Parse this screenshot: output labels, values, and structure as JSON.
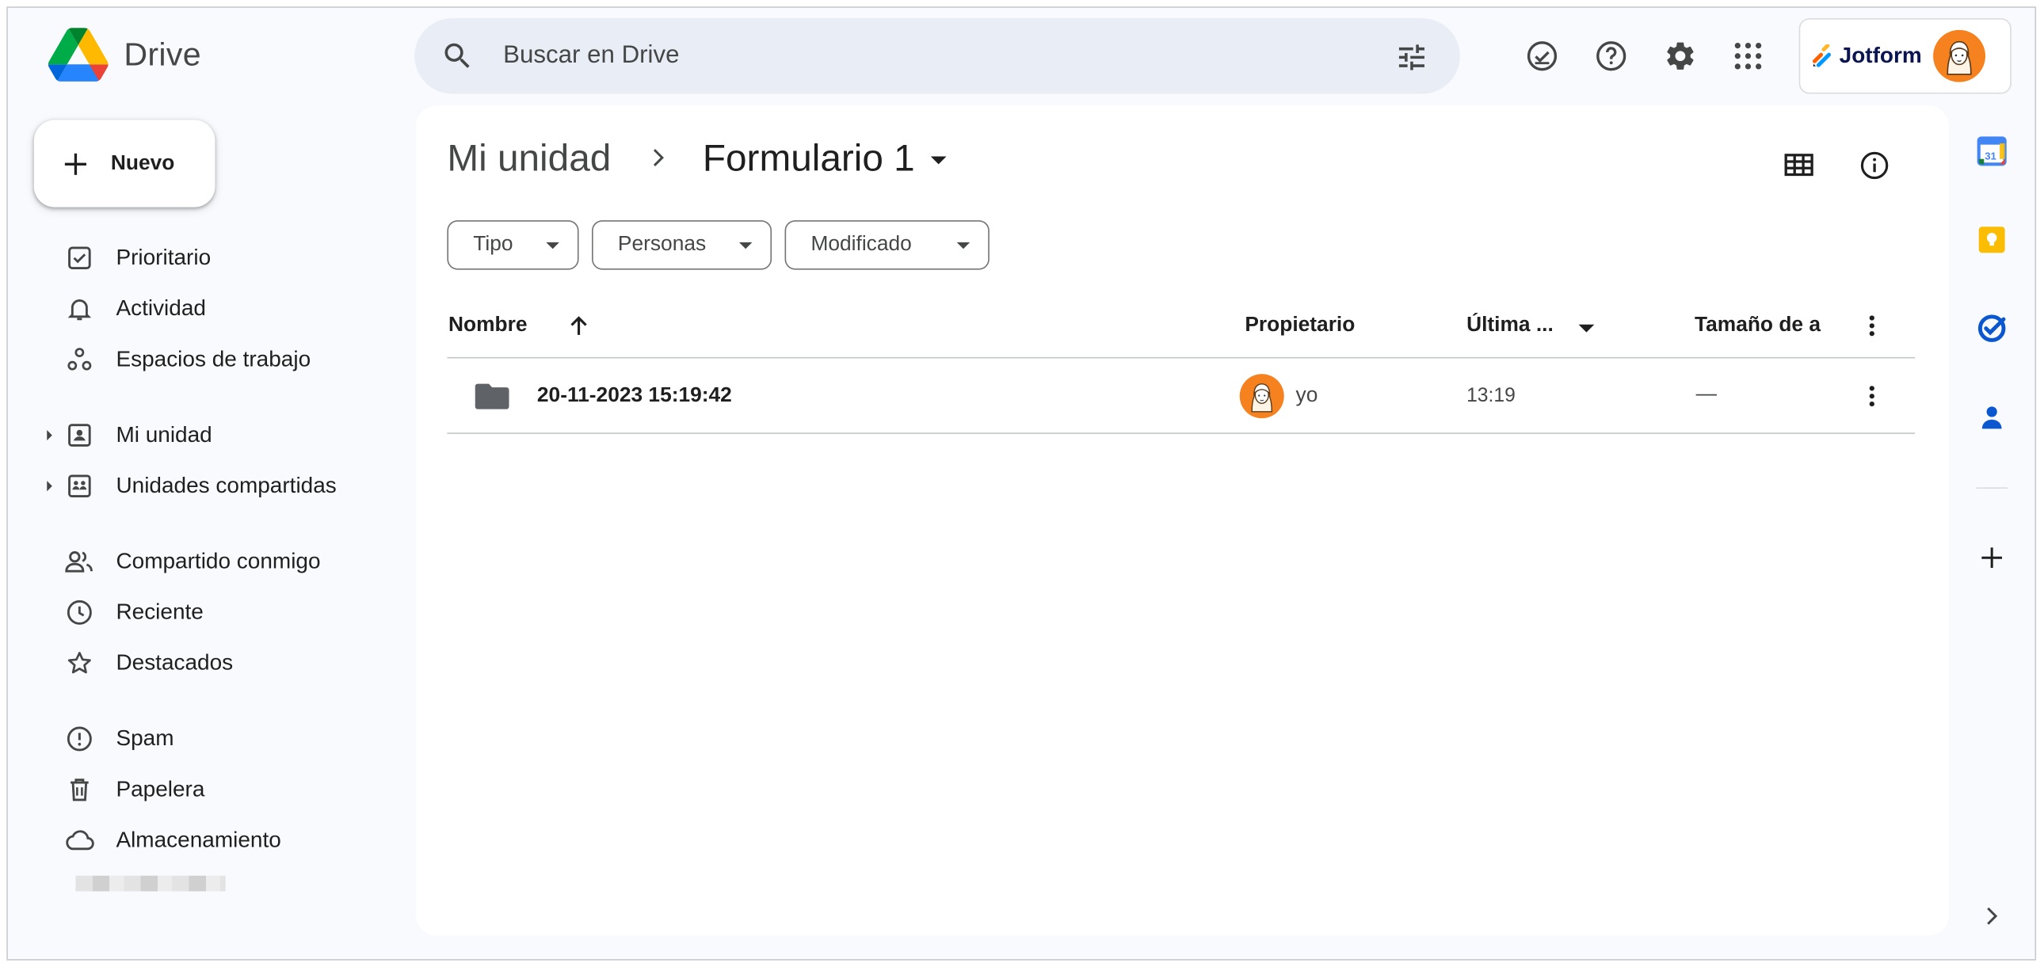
{
  "app": {
    "name": "Drive"
  },
  "search": {
    "placeholder": "Buscar en Drive"
  },
  "account": {
    "brand": "Jotform"
  },
  "new_button": {
    "label": "Nuevo"
  },
  "sidebar": {
    "items": [
      {
        "label": "Prioritario",
        "icon": "priority-icon"
      },
      {
        "label": "Actividad",
        "icon": "bell-icon"
      },
      {
        "label": "Espacios de trabajo",
        "icon": "workspaces-icon"
      },
      {
        "label": "Mi unidad",
        "icon": "my-drive-icon"
      },
      {
        "label": "Unidades compartidas",
        "icon": "shared-drives-icon"
      },
      {
        "label": "Compartido conmigo",
        "icon": "people-icon"
      },
      {
        "label": "Reciente",
        "icon": "clock-icon"
      },
      {
        "label": "Destacados",
        "icon": "star-icon"
      },
      {
        "label": "Spam",
        "icon": "spam-icon"
      },
      {
        "label": "Papelera",
        "icon": "trash-icon"
      },
      {
        "label": "Almacenamiento",
        "icon": "cloud-icon"
      }
    ]
  },
  "breadcrumb": {
    "root": "Mi unidad",
    "current": "Formulario 1"
  },
  "filters": [
    {
      "label": "Tipo"
    },
    {
      "label": "Personas"
    },
    {
      "label": "Modificado"
    }
  ],
  "table": {
    "columns": {
      "name": "Nombre",
      "owner": "Propietario",
      "modified": "Última ...",
      "size": "Tamaño de a"
    },
    "rows": [
      {
        "name": "20-11-2023 15:19:42",
        "owner": "yo",
        "modified": "13:19",
        "size": "—"
      }
    ]
  },
  "colors": {
    "accent": "#0b57d0",
    "surface": "#f8fafd",
    "search_bg": "#e9eef6",
    "text": "#1f1f1f"
  }
}
